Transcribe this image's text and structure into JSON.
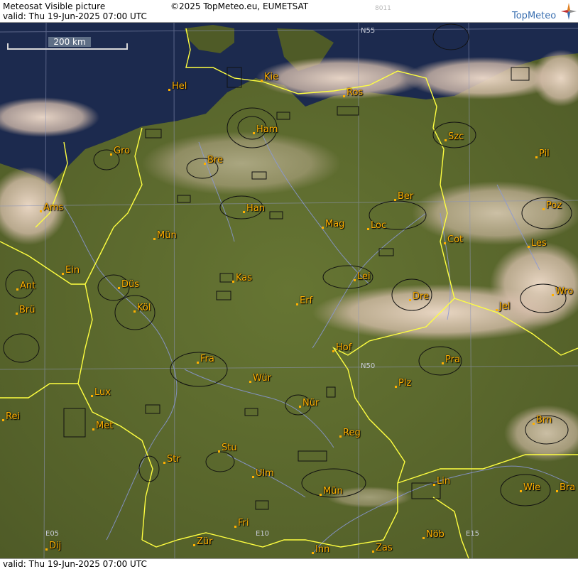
{
  "header": {
    "title": "Meteosat Visible picture",
    "copyright": "©2025 TopMeteo.eu, EUMETSAT",
    "code": "8011",
    "valid": "valid:  Thu  19-Jun-2025  07:00 UTC",
    "brand": "TopMeteo"
  },
  "footer": {
    "valid": "valid:  Thu  19-Jun-2025  07:00 UTC"
  },
  "scale": {
    "label": "200 km"
  },
  "grid_labels": {
    "n55": "N55",
    "n50": "N50",
    "e05": "E05",
    "e10": "E10",
    "e15": "E15"
  },
  "colors": {
    "border": "#ffff40",
    "river": "#8a98d8",
    "city": "#ffb000",
    "sea": "#1c2a4e",
    "land": "#5d6a2e",
    "cloud": "#e6d2c0",
    "brand": "#3a6fb0"
  },
  "cities": [
    {
      "name": "Kie"
    },
    {
      "name": "Hel"
    },
    {
      "name": "Ros"
    },
    {
      "name": "Ham"
    },
    {
      "name": "Szc"
    },
    {
      "name": "Gro"
    },
    {
      "name": "Bre"
    },
    {
      "name": "Pil"
    },
    {
      "name": "Ber"
    },
    {
      "name": "Ams"
    },
    {
      "name": "Han"
    },
    {
      "name": "Poz"
    },
    {
      "name": "Mün"
    },
    {
      "name": "Mag"
    },
    {
      "name": "Loc"
    },
    {
      "name": "Cot"
    },
    {
      "name": "Les"
    },
    {
      "name": "Ein"
    },
    {
      "name": "Kas"
    },
    {
      "name": "Lei"
    },
    {
      "name": "Ant"
    },
    {
      "name": "Düs"
    },
    {
      "name": "Dre"
    },
    {
      "name": "Wro"
    },
    {
      "name": "Erf"
    },
    {
      "name": "Jel"
    },
    {
      "name": "Brü"
    },
    {
      "name": "Köl"
    },
    {
      "name": "Hof"
    },
    {
      "name": "Fra"
    },
    {
      "name": "Pra"
    },
    {
      "name": "Wür"
    },
    {
      "name": "Plz"
    },
    {
      "name": "Lux"
    },
    {
      "name": "Nür"
    },
    {
      "name": "Rei"
    },
    {
      "name": "Met"
    },
    {
      "name": "Reg"
    },
    {
      "name": "Brn"
    },
    {
      "name": "Stu"
    },
    {
      "name": "Str"
    },
    {
      "name": "Lin"
    },
    {
      "name": "Ulm"
    },
    {
      "name": "Mün"
    },
    {
      "name": "Wie"
    },
    {
      "name": "Bra"
    },
    {
      "name": "Fri"
    },
    {
      "name": "Dij"
    },
    {
      "name": "Zür"
    },
    {
      "name": "Inn"
    },
    {
      "name": "Zas"
    },
    {
      "name": "Nöb"
    }
  ]
}
